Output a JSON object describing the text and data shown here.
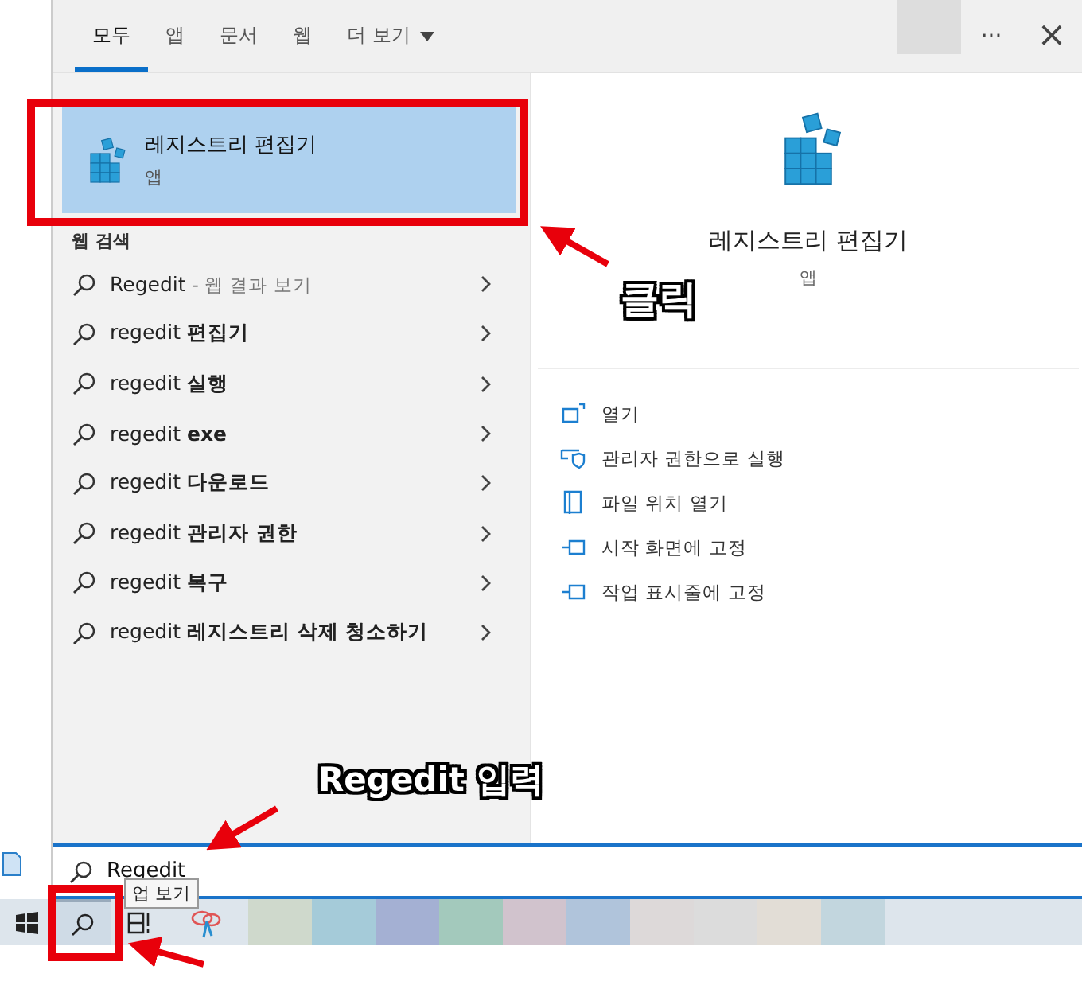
{
  "tabs": [
    {
      "label": "모두",
      "kind": "tab",
      "selected": true
    },
    {
      "label": "앱",
      "kind": "tab",
      "selected": false
    },
    {
      "label": "문서",
      "kind": "tab",
      "selected": false
    },
    {
      "label": "웹",
      "kind": "tab",
      "selected": false
    },
    {
      "label": "더 보기",
      "kind": "dropdown",
      "selected": false
    }
  ],
  "toolbar": {
    "more": "···",
    "close": "×"
  },
  "best_match": {
    "title": "레지스트리 편집기",
    "subtitle": "앱",
    "selected": true
  },
  "web_search": {
    "header": "웹 검색",
    "results": [
      {
        "text": "Regedit",
        "note": "- 웹 결과 보기"
      },
      {
        "text": "regedit **편집기**"
      },
      {
        "text": "regedit **실행**"
      },
      {
        "text": "regedit **exe**"
      },
      {
        "text": "regedit **다운로드**"
      },
      {
        "text": "regedit **관리자 권한**"
      },
      {
        "text": "regedit **복구**"
      },
      {
        "text": "regedit **레지스트리 삭제 청소하기**"
      }
    ]
  },
  "details": {
    "title": "레지스트리 편집기",
    "subtitle": "앱",
    "actions": [
      {
        "label": "열기",
        "kind": "open"
      },
      {
        "label": "관리자 권한으로 실행",
        "kind": "admin"
      },
      {
        "label": "파일 위치 열기",
        "kind": "folder"
      },
      {
        "label": "시작 화면에 고정",
        "kind": "pin"
      },
      {
        "label": "작업 표시줄에 고정",
        "kind": "pin"
      }
    ]
  },
  "search_box": {
    "value": "Regedit",
    "tooltip": "업 보기"
  },
  "annotations": [
    {
      "kind": "label",
      "text": "클릭"
    },
    {
      "kind": "label",
      "text": "Regedit 입력"
    }
  ]
}
